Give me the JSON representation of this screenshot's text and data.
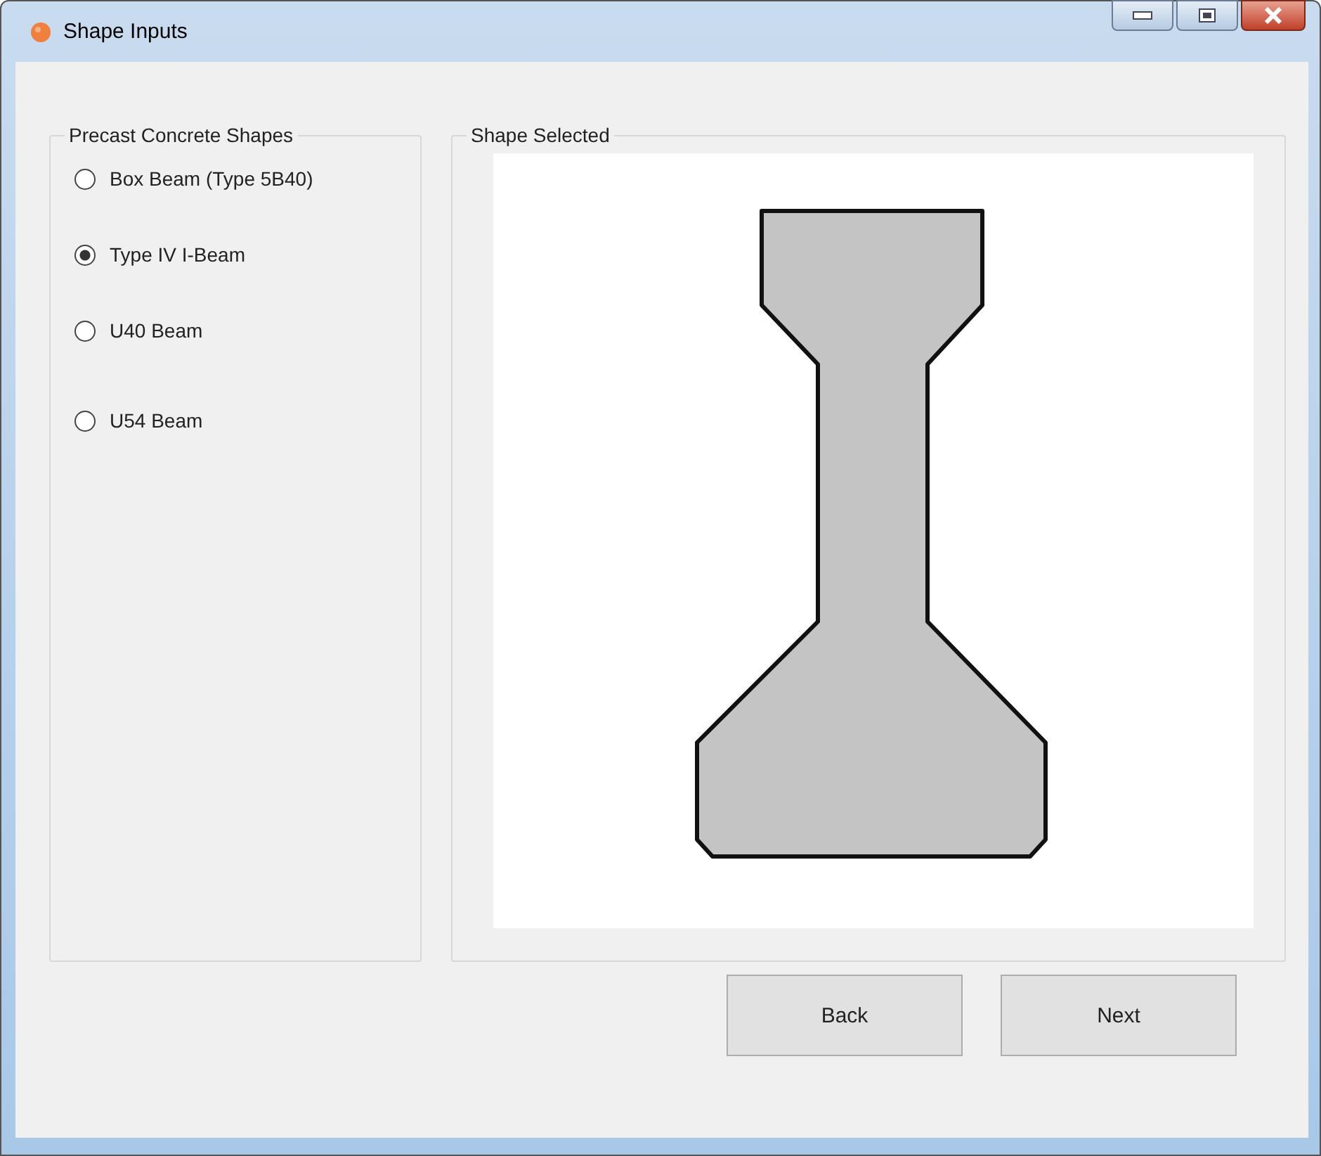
{
  "window": {
    "title": "Shape Inputs"
  },
  "shapes_group": {
    "title": "Precast Concrete Shapes",
    "options": [
      {
        "label": "Box Beam (Type 5B40)",
        "selected": false
      },
      {
        "label": "Type IV I-Beam",
        "selected": true
      },
      {
        "label": "U40 Beam",
        "selected": false
      },
      {
        "label": "U54 Beam",
        "selected": false
      }
    ]
  },
  "preview_group": {
    "title": "Shape Selected"
  },
  "buttons": [
    {
      "label": "Back"
    },
    {
      "label": "Next"
    }
  ]
}
